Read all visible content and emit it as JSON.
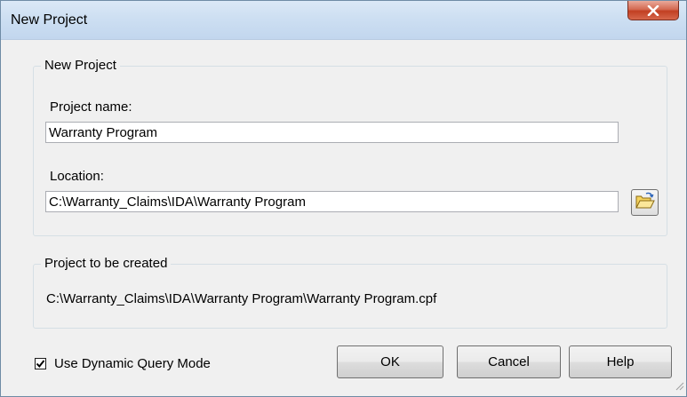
{
  "window": {
    "title": "New Project",
    "close_icon": "close-x-icon"
  },
  "new_project_group": {
    "legend": "New Project",
    "project_name_label": "Project name:",
    "project_name_value": "Warranty Program",
    "location_label": "Location:",
    "location_value": "C:\\Warranty_Claims\\IDA\\Warranty Program",
    "browse_icon": "open-folder-icon"
  },
  "created_group": {
    "legend": "Project to be created",
    "path": "C:\\Warranty_Claims\\IDA\\Warranty Program\\Warranty Program.cpf"
  },
  "options": {
    "dynamic_query_label": "Use Dynamic Query Mode",
    "dynamic_query_checked": true
  },
  "buttons": {
    "ok": "OK",
    "cancel": "Cancel",
    "help": "Help"
  },
  "colors": {
    "titlebar": "#cddff2",
    "close_button": "#c94a2e",
    "dialog_background": "#f0f0f0"
  }
}
